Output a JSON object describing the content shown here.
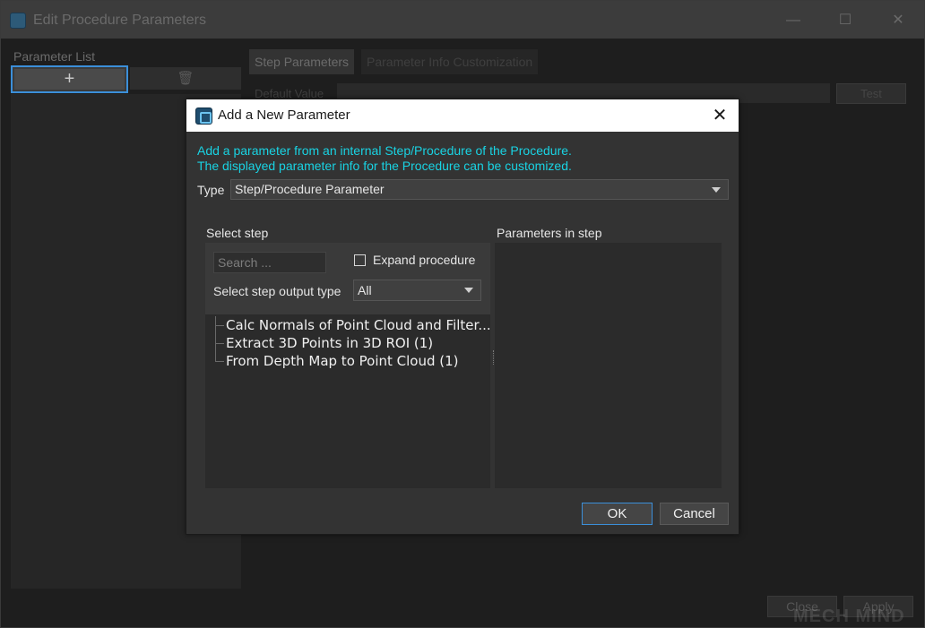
{
  "window": {
    "title": "Edit Procedure Parameters",
    "minimize_glyph": "—",
    "maximize_glyph": "☐",
    "close_glyph": "✕",
    "parameter_list_label": "Parameter List",
    "add_glyph": "+",
    "delete_glyph": "🗑",
    "tabs": [
      "Step Parameters",
      "Parameter Info Customization"
    ],
    "default_value_label": "Default Value",
    "test_label": "Test",
    "close_label": "Close",
    "apply_label": "Apply",
    "watermark": "MECH MIND"
  },
  "dialog": {
    "title": "Add a New Parameter",
    "close_glyph": "✕",
    "info_line1": "Add a parameter from an internal Step/Procedure of the Procedure.",
    "info_line2": "The displayed parameter info for the Procedure can be customized.",
    "type_label": "Type",
    "type_value": "Step/Procedure Parameter",
    "select_step_label": "Select step",
    "params_in_step_label": "Parameters in step",
    "search_placeholder": "Search ...",
    "expand_label": "Expand procedure",
    "expand_checked": false,
    "output_type_label": "Select step output type",
    "output_type_value": "All",
    "steps": [
      "Calc Normals of Point Cloud and Filter...",
      "Extract 3D Points in 3D ROI (1)",
      "From Depth Map to Point Cloud (1)"
    ],
    "ok_label": "OK",
    "cancel_label": "Cancel"
  },
  "colors": {
    "info_text": "#19d3e3",
    "focus_border": "#3b8fd9",
    "dialog_bg": "#333333"
  }
}
